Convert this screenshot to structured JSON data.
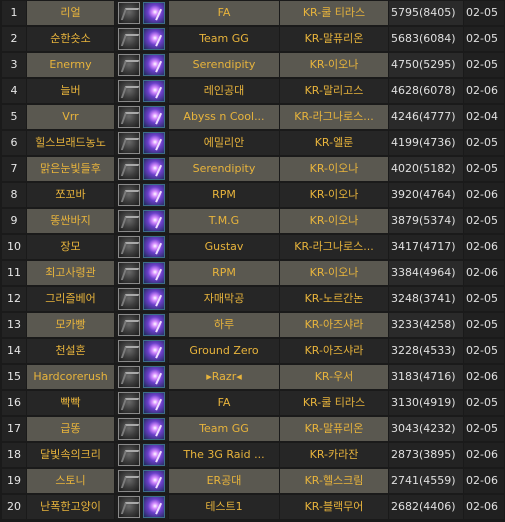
{
  "leaderboard": {
    "rows": [
      {
        "rank": "1",
        "name": "리얼",
        "guild": "FA",
        "realm": "KR-쿨 티라스",
        "score": "5795(8405)",
        "date": "02-05"
      },
      {
        "rank": "2",
        "name": "순한숏소",
        "guild": "Team GG",
        "realm": "KR-말퓨리온",
        "score": "5683(6084)",
        "date": "02-05"
      },
      {
        "rank": "3",
        "name": "Enermy",
        "guild": "Serendipity",
        "realm": "KR-이오나",
        "score": "4750(5295)",
        "date": "02-05"
      },
      {
        "rank": "4",
        "name": "늘버",
        "guild": "레인공대",
        "realm": "KR-말리고스",
        "score": "4628(6078)",
        "date": "02-06"
      },
      {
        "rank": "5",
        "name": "Vrr",
        "guild": "Abyss n Cool...",
        "realm": "KR-라그나로스...",
        "score": "4246(4777)",
        "date": "02-04"
      },
      {
        "rank": "6",
        "name": "힐스브래드농노",
        "guild": "에밀리안",
        "realm": "KR-엘룬",
        "score": "4199(4736)",
        "date": "02-05"
      },
      {
        "rank": "7",
        "name": "맑은눈빛들후",
        "guild": "Serendipity",
        "realm": "KR-이오나",
        "score": "4020(5182)",
        "date": "02-05"
      },
      {
        "rank": "8",
        "name": "쪼꼬바",
        "guild": "RPM",
        "realm": "KR-이오나",
        "score": "3920(4764)",
        "date": "02-06"
      },
      {
        "rank": "9",
        "name": "똥싼바지",
        "guild": "T.M.G",
        "realm": "KR-이오나",
        "score": "3879(5374)",
        "date": "02-05"
      },
      {
        "rank": "10",
        "name": "장모",
        "guild": "Gustav",
        "realm": "KR-라그나로스...",
        "score": "3417(4717)",
        "date": "02-06"
      },
      {
        "rank": "11",
        "name": "최고사령관",
        "guild": "RPM",
        "realm": "KR-이오나",
        "score": "3384(4964)",
        "date": "02-06"
      },
      {
        "rank": "12",
        "name": "그리즐베어",
        "guild": "자매막공",
        "realm": "KR-노르간논",
        "score": "3248(3741)",
        "date": "02-05"
      },
      {
        "rank": "13",
        "name": "모카빵",
        "guild": "하루",
        "realm": "KR-아즈샤라",
        "score": "3233(4258)",
        "date": "02-05"
      },
      {
        "rank": "14",
        "name": "천설혼",
        "guild": "Ground Zero",
        "realm": "KR-아즈샤라",
        "score": "3228(4533)",
        "date": "02-05"
      },
      {
        "rank": "15",
        "name": "Hardcorerush",
        "guild": "▸Razr◂",
        "realm": "KR-우서",
        "score": "3183(4716)",
        "date": "02-06"
      },
      {
        "rank": "16",
        "name": "빡빡",
        "guild": "FA",
        "realm": "KR-쿨 티라스",
        "score": "3130(4919)",
        "date": "02-05"
      },
      {
        "rank": "17",
        "name": "급똥",
        "guild": "Team GG",
        "realm": "KR-말퓨리온",
        "score": "3043(4232)",
        "date": "02-05"
      },
      {
        "rank": "18",
        "name": "달빛속의크리",
        "guild": "The 3G Raid ...",
        "realm": "KR-카라잔",
        "score": "2873(3895)",
        "date": "02-06"
      },
      {
        "rank": "19",
        "name": "스토니",
        "guild": "ER공대",
        "realm": "KR-헬스크림",
        "score": "2741(4559)",
        "date": "02-06"
      },
      {
        "rank": "20",
        "name": "난폭한고양이",
        "guild": "테스트1",
        "realm": "KR-블랙무어",
        "score": "2682(4406)",
        "date": "02-06"
      }
    ]
  },
  "icons": {
    "class": "warrior-class-icon",
    "spec": "spec-ability-icon"
  },
  "colors": {
    "accent": "#e8b43c",
    "row_highlight": "#5a5850",
    "background": "#1a1a1a"
  }
}
